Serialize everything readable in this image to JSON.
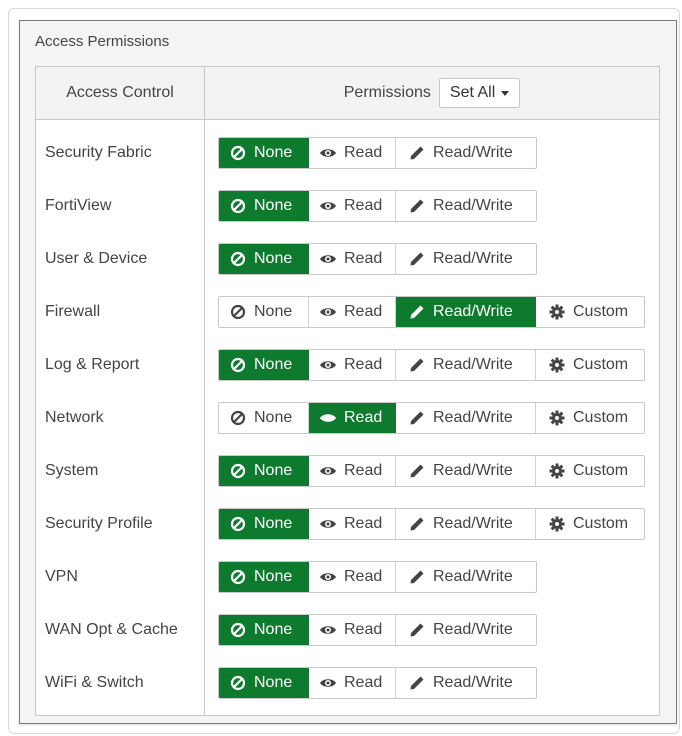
{
  "panel": {
    "title": "Access Permissions"
  },
  "table": {
    "col_access_control": "Access Control",
    "col_permissions": "Permissions",
    "set_all_label": "Set All"
  },
  "labels": {
    "none": "None",
    "read": "Read",
    "read_write": "Read/Write",
    "custom": "Custom"
  },
  "rows": [
    {
      "label": "Security Fabric",
      "selected": "None",
      "has_custom": false
    },
    {
      "label": "FortiView",
      "selected": "None",
      "has_custom": false
    },
    {
      "label": "User & Device",
      "selected": "None",
      "has_custom": false
    },
    {
      "label": "Firewall",
      "selected": "Read/Write",
      "has_custom": true
    },
    {
      "label": "Log & Report",
      "selected": "None",
      "has_custom": true
    },
    {
      "label": "Network",
      "selected": "Read",
      "has_custom": true
    },
    {
      "label": "System",
      "selected": "None",
      "has_custom": true
    },
    {
      "label": "Security Profile",
      "selected": "None",
      "has_custom": true
    },
    {
      "label": "VPN",
      "selected": "None",
      "has_custom": false
    },
    {
      "label": "WAN Opt & Cache",
      "selected": "None",
      "has_custom": false
    },
    {
      "label": "WiFi & Switch",
      "selected": "None",
      "has_custom": false
    }
  ],
  "colors": {
    "active": "#0e7a2e",
    "border": "#c8c8c8"
  },
  "icons": {
    "none": "ban-icon",
    "read": "eye-icon",
    "read_write": "pencil-icon",
    "custom": "gear-icon"
  }
}
